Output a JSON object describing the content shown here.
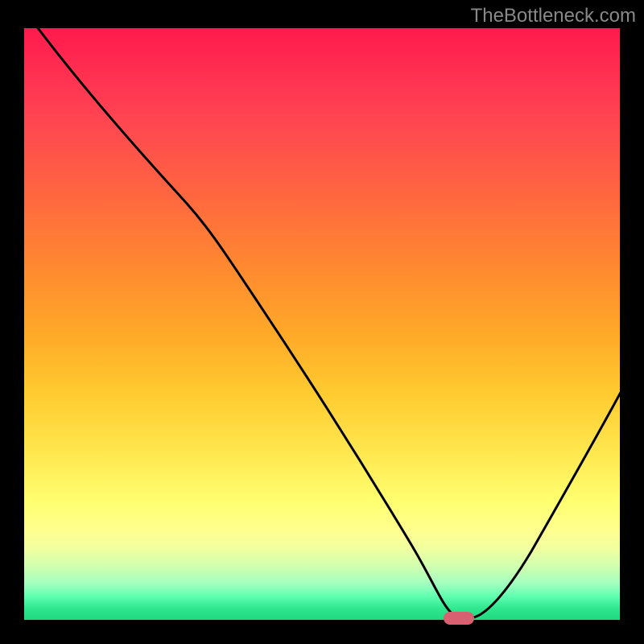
{
  "watermark": "TheBottleneck.com",
  "chart_data": {
    "type": "line",
    "title": "",
    "xlabel": "",
    "ylabel": "",
    "xlim": [
      0,
      100
    ],
    "ylim": [
      0,
      100
    ],
    "x": [
      0,
      10,
      20,
      26,
      32,
      40,
      50,
      60,
      68,
      70,
      72,
      75,
      80,
      85,
      90,
      95,
      100
    ],
    "values": [
      108,
      94,
      80,
      72,
      62,
      50,
      35,
      20,
      6,
      2,
      0,
      0,
      2,
      10,
      20,
      30,
      40
    ],
    "marker": {
      "x": 73,
      "y": 0
    },
    "gradient_colors": {
      "top": "#ff1a4d",
      "mid_upper": "#ff8830",
      "mid": "#ffe850",
      "mid_lower": "#ffff90",
      "bottom": "#20d880"
    }
  }
}
